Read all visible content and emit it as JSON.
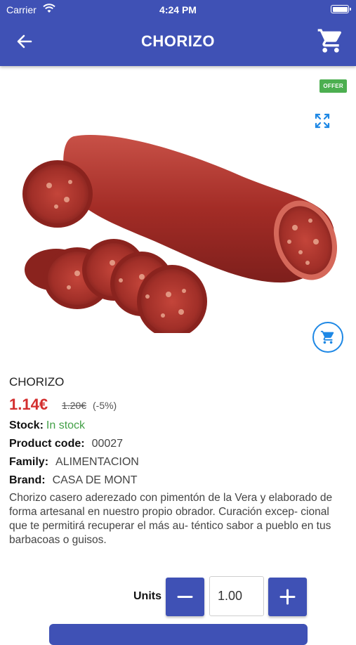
{
  "status_bar": {
    "carrier": "Carrier",
    "time": "4:24 PM"
  },
  "nav": {
    "title": "CHORIZO",
    "back_icon": "arrow-back-icon",
    "cart_icon": "shopping-cart-icon"
  },
  "image": {
    "badge": "OFFER",
    "expand_icon": "fullscreen-icon",
    "add_cart_icon": "add-to-cart-icon"
  },
  "product": {
    "name": "CHORIZO",
    "price": "1.14€",
    "old_price": "1.20€",
    "discount": "(-5%)",
    "stock_label": "Stock:",
    "stock_value": "In stock",
    "code_label": "Product code:",
    "code_value": "00027",
    "family_label": "Family:",
    "family_value": "ALIMENTACION",
    "brand_label": "Brand:",
    "brand_value": "CASA DE MONT",
    "description": "Chorizo casero aderezado con pimentón de la Vera y elaborado de forma artesanal en nuestro propio obrador. Curación excep- cional que te permitirá recuperar el más au- téntico sabor a pueblo en tus barbacoas o guisos."
  },
  "quantity": {
    "label": "Units",
    "value": "1.00"
  },
  "colors": {
    "primary": "#3f51b5",
    "price": "#d32f2f",
    "in_stock": "#43a047",
    "offer_badge": "#4caf50",
    "accent_blue": "#1e88e5"
  }
}
